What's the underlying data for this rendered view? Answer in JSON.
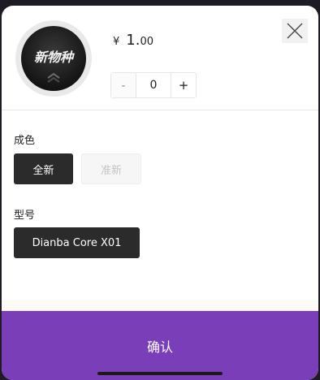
{
  "product": {
    "image_text": "新物种",
    "price_symbol": "¥",
    "price_integer": "1.",
    "price_decimal": "00"
  },
  "quantity": {
    "decrement_label": "-",
    "value": "0",
    "increment_label": "+"
  },
  "condition": {
    "label": "成色",
    "options": [
      {
        "label": "全新",
        "state": "selected"
      },
      {
        "label": "准新",
        "state": "disabled"
      }
    ]
  },
  "model": {
    "label": "型号",
    "options": [
      {
        "label": "Dianba Core X01",
        "state": "selected"
      }
    ]
  },
  "confirm": {
    "label": "确认"
  },
  "icons": {
    "close": "close-icon",
    "thumb_chevron": "chevron-up-icon"
  },
  "colors": {
    "accent": "#7a3fb8",
    "selected_option": "#2b2b2b"
  }
}
